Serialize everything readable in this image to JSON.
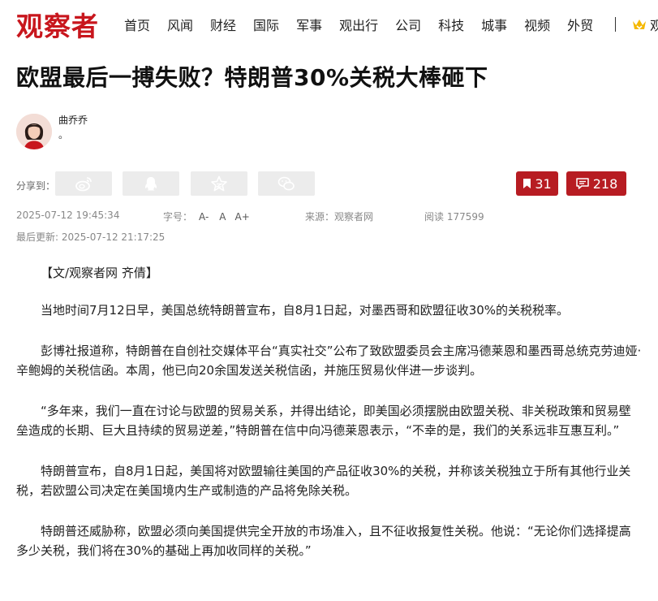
{
  "header": {
    "logo": "观察者",
    "nav": [
      "首页",
      "风闻",
      "财经",
      "国际",
      "军事",
      "观出行",
      "公司",
      "科技",
      "城事",
      "视频",
      "外贸"
    ],
    "vip_label": "观"
  },
  "article": {
    "title": "欧盟最后一搏失败？特朗普30%关税大棒砸下",
    "author": {
      "name": "曲乔乔",
      "desc": "。"
    },
    "share_label": "分享到：",
    "share_icons": [
      "weibo-icon",
      "qq-icon",
      "qzone-star-icon",
      "wechat-icon"
    ],
    "bookmark_count": "31",
    "comment_count": "218",
    "meta": {
      "published": "2025-07-12 19:45:34",
      "font_size_label": "字号：",
      "font_decrease": "A-",
      "font_normal": "A",
      "font_increase": "A+",
      "source": "来源：观察者网",
      "views": "阅读 177599",
      "updated": "最后更新: 2025-07-12 21:17:25"
    },
    "paragraphs": [
      "【文/观察者网 齐倩】",
      "当地时间7月12日早，美国总统特朗普宣布，自8月1日起，对墨西哥和欧盟征收30%的关税税率。",
      "彭博社报道称，特朗普在自创社交媒体平台“真实社交”公布了致欧盟委员会主席冯德莱恩和墨西哥总统克劳迪娅·辛鲍姆的关税信函。本周，他已向20余国发送关税信函，并施压贸易伙伴进一步谈判。",
      "“多年来，我们一直在讨论与欧盟的贸易关系，并得出结论，即美国必须摆脱由欧盟关税、非关税政策和贸易壁垒造成的长期、巨大且持续的贸易逆差，”特朗普在信中向冯德莱恩表示，“不幸的是，我们的关系远非互惠互利。”",
      "特朗普宣布，自8月1日起，美国将对欧盟输往美国的产品征收30%的关税，并称该关税独立于所有其他行业关税，若欧盟公司决定在美国境内生产或制造的产品将免除关税。",
      "特朗普还威胁称，欧盟必须向美国提供完全开放的市场准入，且不征收报复性关税。他说：“无论你们选择提高多少关税，我们将在30%的基础上再加收同样的关税。”"
    ]
  },
  "colors": {
    "brand_red": "#c8161d",
    "button_red": "#b71c22",
    "vip_gold": "#f5b800"
  }
}
